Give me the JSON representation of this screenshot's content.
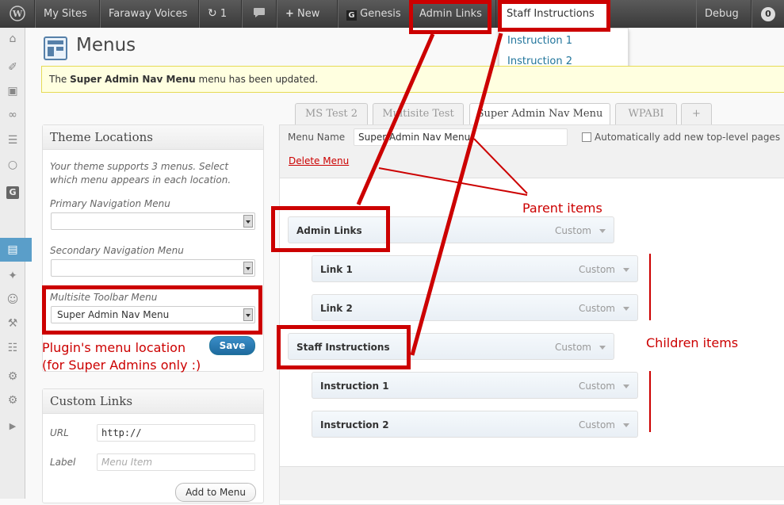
{
  "admin_bar": {
    "my_sites": "My Sites",
    "site_name": "Faraway Voices",
    "updates_count": "1",
    "new_label": "New",
    "genesis": "Genesis",
    "admin_links": "Admin Links",
    "staff_instructions": "Staff Instructions",
    "staff_dropdown": [
      "Instruction 1",
      "Instruction 2"
    ],
    "debug": "Debug",
    "debug_count": "0"
  },
  "page": {
    "title": "Menus",
    "notice_prefix": "The",
    "notice_menu": "Super Admin Nav Menu",
    "notice_suffix": "menu has been updated."
  },
  "theme_locations": {
    "title": "Theme Locations",
    "help": "Your theme supports 3 menus. Select which menu appears in each location.",
    "primary_label": "Primary Navigation Menu",
    "primary_value": "",
    "secondary_label": "Secondary Navigation Menu",
    "secondary_value": "",
    "toolbar_label": "Multisite Toolbar Menu",
    "toolbar_value": "Super Admin Nav Menu",
    "save": "Save"
  },
  "custom_links": {
    "title": "Custom Links",
    "url_label": "URL",
    "url_value": "http://",
    "label_label": "Label",
    "label_placeholder": "Menu Item",
    "add_button": "Add to Menu"
  },
  "tabs": [
    "MS Test 2",
    "Multisite Test",
    "Super Admin Nav Menu",
    "WPABI",
    "+"
  ],
  "menu_editor": {
    "name_label": "Menu Name",
    "name_value": "Super Admin Nav Menu",
    "auto_add": "Automatically add new top-level pages",
    "delete": "Delete Menu",
    "items": [
      {
        "title": "Admin Links",
        "type": "Custom"
      },
      {
        "title": "Link 1",
        "type": "Custom"
      },
      {
        "title": "Link 2",
        "type": "Custom"
      },
      {
        "title": "Staff Instructions",
        "type": "Custom"
      },
      {
        "title": "Instruction 1",
        "type": "Custom"
      },
      {
        "title": "Instruction 2",
        "type": "Custom"
      }
    ]
  },
  "annotations": {
    "parent": "Parent items",
    "children": "Children items",
    "plugin_line1": "Plugin's menu location",
    "plugin_line2": "(for Super Admins only :)"
  },
  "colors": {
    "annotation": "#cc0000",
    "link": "#21759b",
    "admin_bar": "#464646"
  }
}
